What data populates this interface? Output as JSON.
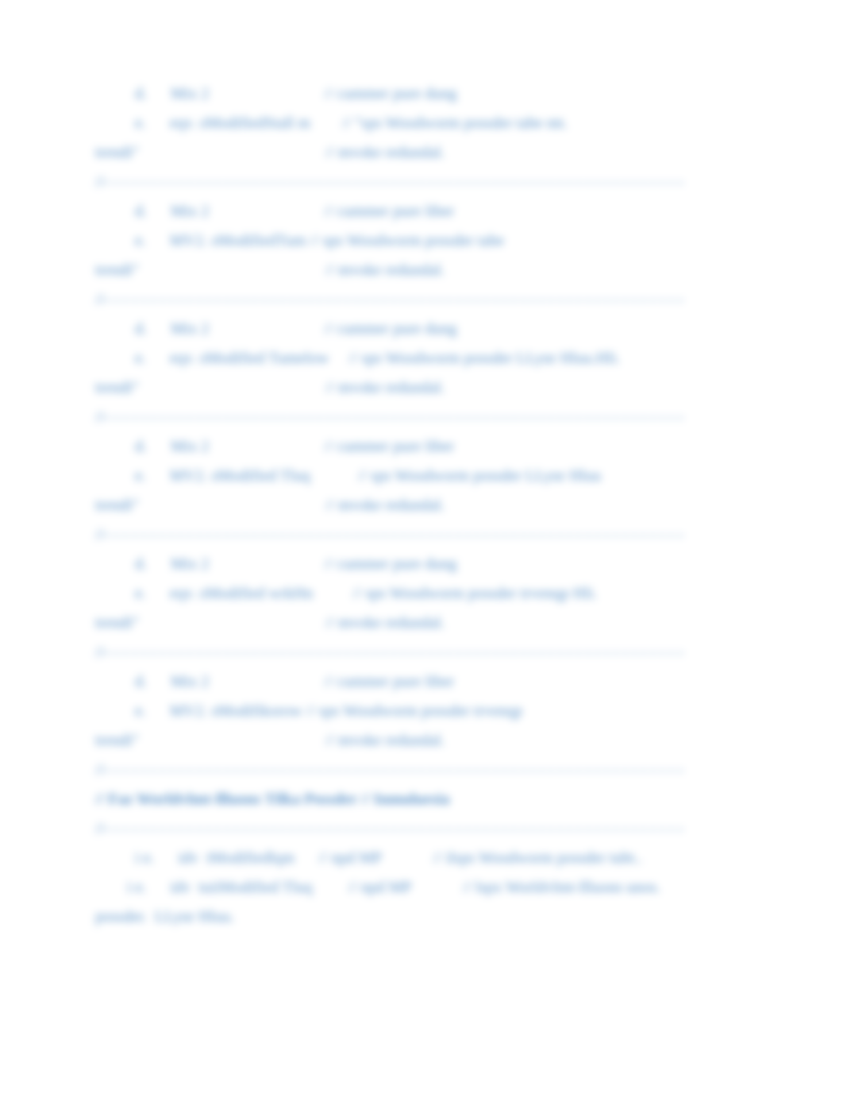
{
  "lines": [
    {
      "cls": "indent1",
      "text": "d.      Mix 2                             // cummer pure dung"
    },
    {
      "cls": "indent1",
      "text": "e.      eqv. sModifiedStall m        // \"sps Woodworm possder tabe mt."
    },
    {
      "cls": "hang",
      "text": "trendi\"                                               // mvoke redundal."
    },
    {
      "cls": "dashRow",
      "text": "//- - - - - - - - - - - - - - - - - - - - - - - - - - - - - - - - - - - - - - - - - - - - - - - - - - - - - - - - - - - - - - -"
    },
    {
      "cls": "indent1",
      "text": "d.      Mix 2                             // cummer pure liber"
    },
    {
      "cls": "indent1",
      "text": "e.      MV2. sModifiedTum // sps Woodworm possder tabe"
    },
    {
      "cls": "hang",
      "text": "trendi\"                                               // mvoke redundal."
    },
    {
      "cls": "dashRow",
      "text": "//- - - - - - - - - - - - - - - - - - - - - - - - - - - - - - - - - - - - - - - - - - - - - - - - - - - - - - - - - - - - - - -"
    },
    {
      "cls": "indent1",
      "text": "d.      Mix 2                             // cummer pure dung"
    },
    {
      "cls": "indent1",
      "text": "e.      eqv. sModified Tumelow     // sps Woodworm possder LLynr Hluu.Hli."
    },
    {
      "cls": "hang",
      "text": "trendi\"                                               // mvoke redundal."
    },
    {
      "cls": "dashRow",
      "text": "//- - - - - - - - - - - - - - - - - - - - - - - - - - - - - - - - - - - - - - - - - - - - - - - - - - - - - - - - - - - - - - -"
    },
    {
      "cls": "indent1",
      "text": "d.      Mix 2                             // cummer pure liber"
    },
    {
      "cls": "indent1",
      "text": "e.      MV2. sModified Tluq            // sps Woodworm possder LLynr Hluu"
    },
    {
      "cls": "hang",
      "text": "trendi\"                                               // mvoke redundal."
    },
    {
      "cls": "dashRow",
      "text": "//- - - - - - - - - - - - - - - - - - - - - - - - - - - - - - - - - - - - - - - - - - - - - - - - - - - - - - - - - - - - - - -"
    },
    {
      "cls": "indent1",
      "text": "d.      Mix 2                             // cummer pure dung"
    },
    {
      "cls": "indent1",
      "text": "e.      eqv. sModified wrkHn          // sps Woodworm possder trvenqp Hli."
    },
    {
      "cls": "hang",
      "text": "trendi\"                                               // mvoke redundal."
    },
    {
      "cls": "dashRow",
      "text": "//- - - - - - - - - - - - - - - - - - - - - - - - - - - - - - - - - - - - - - - - - - - - - - - - - - - - - - - - - - - - - - -"
    },
    {
      "cls": "indent1",
      "text": "d.      Mix 2                             // cummer pure liber"
    },
    {
      "cls": "indent1",
      "text": "e.      MV2. sModifikorow // sps Woodworm possder trvenqp"
    },
    {
      "cls": "hang",
      "text": "trendi\"                                               // mvoke redundal."
    },
    {
      "cls": "dashRow",
      "text": "//- - - - - - - - - - - - - - - - - - - - - - - - - - - - - - - - - - - - - - - - - - - - - - - - - - - - - - - - - - - - - - -"
    },
    {
      "cls": "hang bold",
      "text": "// Faz Worldvlmt-llluons Tilka Possder // Inmuluesia"
    },
    {
      "cls": "dashRow",
      "text": "//- - - - - - - - - - - - - - - - - - - - - - - - - - - - - - - - - - - - - - - - - - - - - - - - - - - - - - - - - - - - - - -"
    },
    {
      "cls": "indent1",
      "text": "i e.      idv  tModifiedlqm      // npd MP             // ilsps Woodworm possder tubt.."
    },
    {
      "cls": "hang",
      "text": "        i e.      idv  tuiiModified Tluq         // npd MP             // lspx Worldvlmt-llluons unos."
    },
    {
      "cls": "hang",
      "text": "possder.  LLynr Hluu."
    }
  ]
}
